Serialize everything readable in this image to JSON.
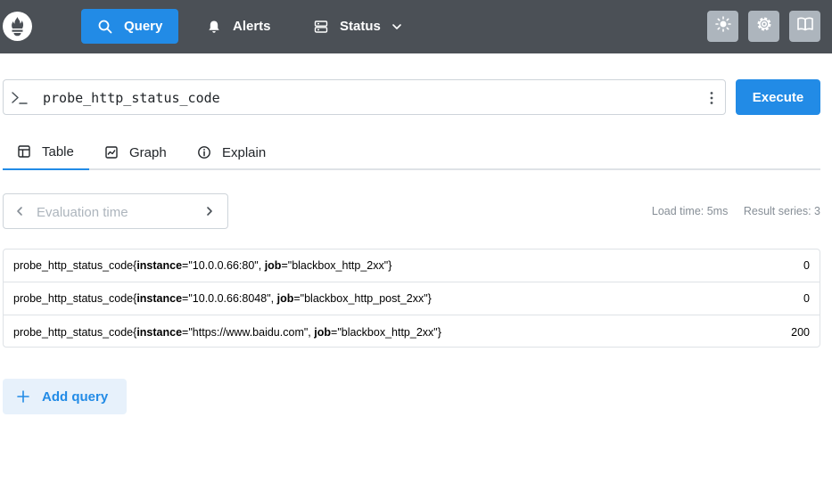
{
  "header": {
    "nav": {
      "query_label": "Query",
      "alerts_label": "Alerts",
      "status_label": "Status"
    },
    "icons": [
      "prometheus-logo-icon",
      "search-icon",
      "bell-icon",
      "server-icon",
      "chevron-down-icon",
      "sun-icon",
      "gear-icon",
      "book-icon"
    ]
  },
  "expression": {
    "value": "probe_http_status_code",
    "execute_label": "Execute"
  },
  "tabs": [
    {
      "label": "Table",
      "active": true
    },
    {
      "label": "Graph",
      "active": false
    },
    {
      "label": "Explain",
      "active": false
    }
  ],
  "evaluation": {
    "placeholder": "Evaluation time"
  },
  "stats": {
    "load_time": "Load time: 5ms",
    "result_series": "Result series: 3"
  },
  "results": [
    {
      "metric": "probe_http_status_code",
      "labels": [
        {
          "key": "instance",
          "value": "\"10.0.0.66:80\""
        },
        {
          "key": "job",
          "value": "\"blackbox_http_2xx\""
        }
      ],
      "value": "0"
    },
    {
      "metric": "probe_http_status_code",
      "labels": [
        {
          "key": "instance",
          "value": "\"10.0.0.66:8048\""
        },
        {
          "key": "job",
          "value": "\"blackbox_http_post_2xx\""
        }
      ],
      "value": "0"
    },
    {
      "metric": "probe_http_status_code",
      "labels": [
        {
          "key": "instance",
          "value": "\"https://www.baidu.com\""
        },
        {
          "key": "job",
          "value": "\"blackbox_http_2xx\""
        }
      ],
      "value": "200"
    }
  ],
  "add_query_label": "Add query",
  "colors": {
    "header_bg": "#4b5056",
    "accent": "#228be6",
    "icon_button_bg": "#adb5bd",
    "add_query_bg": "#e7f1fb"
  }
}
